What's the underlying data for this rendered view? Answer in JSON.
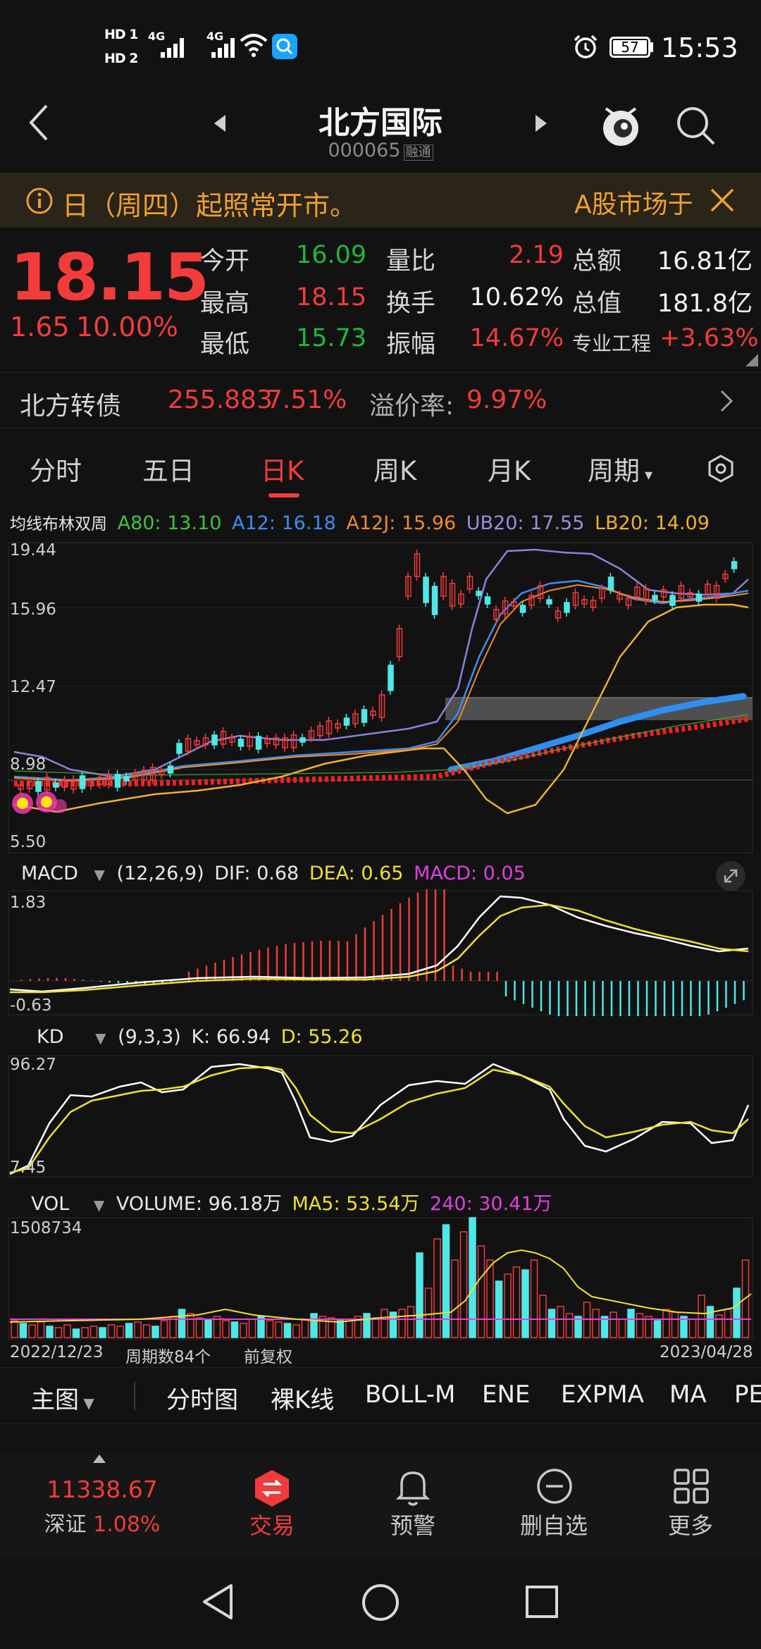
{
  "status": {
    "hd1": "HD 1",
    "hd2": "HD 2",
    "net1": "4G",
    "net2": "4G",
    "battery": "57",
    "time": "15:53"
  },
  "header": {
    "name": "北方国际",
    "code": "000065",
    "tag": "融通"
  },
  "notice": {
    "text": "日（周四）起照常开市。",
    "right": "A股市场于"
  },
  "quote": {
    "price": "18.15",
    "change_abs": "1.65",
    "change_pct": "10.00%",
    "rows": [
      {
        "l1": "今开",
        "v1": "16.09",
        "l2": "量比",
        "v2": "2.19",
        "l3": "总额",
        "v3": "16.81亿"
      },
      {
        "l1": "最高",
        "v1": "18.15",
        "l2": "换手",
        "v2": "10.62%",
        "l3": "总值",
        "v3": "181.8亿"
      },
      {
        "l1": "最低",
        "v1": "15.73",
        "l2": "振幅",
        "v2": "14.67%",
        "l3": "专业工程",
        "v3": "+3.63%"
      }
    ]
  },
  "bond": {
    "name": "北方转债",
    "price": "255.883",
    "pct": "7.51%",
    "premium_label": "溢价率:",
    "premium": "9.97%"
  },
  "tabs": [
    "分时",
    "五日",
    "日K",
    "周K",
    "月K",
    "周期"
  ],
  "main_indicator": {
    "name": "均线布林双周",
    "items": [
      {
        "text": "A80: 13.10",
        "color": "#3ec33e"
      },
      {
        "text": "A12: 16.18",
        "color": "#3b8df0"
      },
      {
        "text": "A12J: 15.96",
        "color": "#f08a2a"
      },
      {
        "text": "UB20: 17.55",
        "color": "#9b8de0"
      },
      {
        "text": "LB20: 14.09",
        "color": "#f0b030"
      }
    ],
    "y_labels": [
      "19.44",
      "15.96",
      "12.47",
      "8.98",
      "5.50"
    ]
  },
  "macd": {
    "name": "MACD",
    "params": "(12,26,9)",
    "dif": "DIF: 0.68",
    "dea": "DEA: 0.65",
    "macd": "MACD: 0.05",
    "y_top": "1.83",
    "y_bottom": "-0.63"
  },
  "kd": {
    "name": "KD",
    "params": "(9,3,3)",
    "k": "K: 66.94",
    "d": "D: 55.26",
    "y_top": "96.27",
    "y_bottom": "7.45"
  },
  "vol": {
    "name": "VOL",
    "volume": "VOLUME: 96.18万",
    "ma5": "MA5: 53.54万",
    "ma240": "240: 30.41万",
    "y_top": "1508734",
    "date_start": "2022/12/23",
    "periods": "周期数84个",
    "adjust": "前复权",
    "date_end": "2023/04/28"
  },
  "toolbar": [
    "主图",
    "分时图",
    "裸K线",
    "BOLL-M",
    "ENE",
    "EXPMA",
    "MA",
    "PE"
  ],
  "bottom_nav": {
    "index_value": "11338.67",
    "index_name": "深证",
    "index_pct": "1.08%",
    "items": [
      "交易",
      "预警",
      "删自选",
      "更多"
    ]
  },
  "colors": {
    "up": "#f23b3b",
    "down": "#4ee8e8",
    "accent": "#f0a030"
  }
}
